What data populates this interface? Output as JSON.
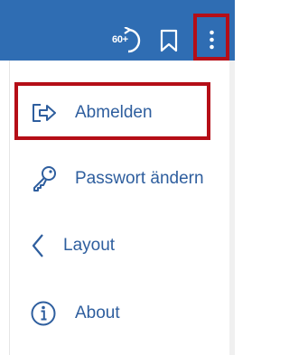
{
  "header": {
    "background_color": "#2f6db3",
    "timer": {
      "label": "60+",
      "icon": "timer-forward-icon"
    },
    "bookmark": {
      "icon": "bookmark-icon"
    },
    "more": {
      "icon": "more-vertical-icon"
    }
  },
  "menu": {
    "items": [
      {
        "label": "Abmelden",
        "icon": "logout-icon"
      },
      {
        "label": "Passwort ändern",
        "icon": "key-icon"
      },
      {
        "label": "Layout",
        "icon": "chevron-left-icon"
      },
      {
        "label": "About",
        "icon": "info-icon"
      }
    ]
  },
  "colors": {
    "accent": "#2e5e9e",
    "highlight": "#b50e17"
  }
}
